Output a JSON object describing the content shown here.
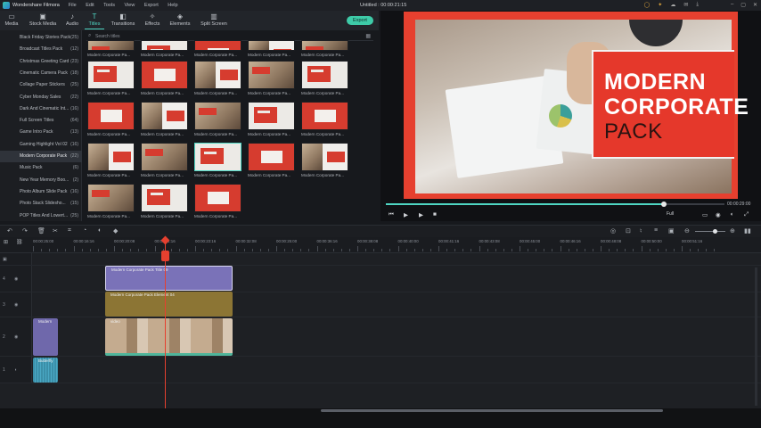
{
  "app": {
    "name": "Wondershare Filmora",
    "menu": [
      "File",
      "Edit",
      "Tools",
      "View",
      "Export",
      "Help"
    ],
    "project": "Untitled : 00:00:21:15"
  },
  "tabs": [
    {
      "label": "Media",
      "icon": "folder-icon"
    },
    {
      "label": "Stock Media",
      "icon": "stock-media-icon"
    },
    {
      "label": "Audio",
      "icon": "music-note-icon"
    },
    {
      "label": "Titles",
      "icon": "text-icon",
      "active": true
    },
    {
      "label": "Transitions",
      "icon": "transition-icon"
    },
    {
      "label": "Effects",
      "icon": "effects-icon"
    },
    {
      "label": "Elements",
      "icon": "elements-icon"
    },
    {
      "label": "Split Screen",
      "icon": "split-screen-icon"
    }
  ],
  "export_label": "Export",
  "search": {
    "placeholder": "Search titles"
  },
  "sidebar": [
    {
      "label": "Black Friday Stories Pack",
      "count": "(25)"
    },
    {
      "label": "Broadcast Titles Pack",
      "count": "(12)"
    },
    {
      "label": "Christmas Greeting Card",
      "count": "(23)"
    },
    {
      "label": "Cinematic Camera Pack",
      "count": "(18)"
    },
    {
      "label": "Collage Paper Stickers",
      "count": "(25)"
    },
    {
      "label": "Cyber Monday Sales",
      "count": "(22)"
    },
    {
      "label": "Dark And Cinematic Int...",
      "count": "(16)"
    },
    {
      "label": "Full Screen Titles",
      "count": "(64)"
    },
    {
      "label": "Game Intro Pack",
      "count": "(13)"
    },
    {
      "label": "Gaming Highlight Vol 02",
      "count": "(16)"
    },
    {
      "label": "Modern Corporate Pack",
      "count": "(22)",
      "active": true
    },
    {
      "label": "Music Pack",
      "count": "(6)"
    },
    {
      "label": "New Year Memory Boo...",
      "count": "(2)"
    },
    {
      "label": "Photo Album Slide Pack",
      "count": "(16)"
    },
    {
      "label": "Photo Stack Slidesho...",
      "count": "(15)"
    },
    {
      "label": "POP Titles And Lowert...",
      "count": "(25)"
    }
  ],
  "thumb_label": "Modern Corporate Pa...",
  "preview": {
    "title_line1": "MODERN",
    "title_line2": "CORPORATE",
    "title_line3": "PACK",
    "progress": 0.82,
    "time": "00:00:29:00",
    "quality": "Full"
  },
  "ruler_labels": [
    "00:00:25:00",
    "00:00:16:16",
    "00:00:20:08",
    "00:00:21:16",
    "00:00:23:16",
    "00:00:32:08",
    "00:00:25:00",
    "00:00:36:16",
    "00:00:38:08",
    "00:00:40:00",
    "00:00:41:16",
    "00:00:43:08",
    "00:00:45:00",
    "00:00:46:16",
    "00:00:48:08",
    "00:00:50:00",
    "00:00:51:16"
  ],
  "clips": {
    "title_clip": "Modern Corporate Pack Title 09",
    "element_clip": "Modern Corporate Pack Element 04",
    "video_clip": "video",
    "small_clip": "Modern",
    "audio_clip": "Butterfly"
  },
  "track_labels": [
    "4",
    "3",
    "2",
    "1"
  ],
  "colors": {
    "accent": "#4fd6c3",
    "brand_red": "#e5402f",
    "title_clip": "#7a72b8",
    "element_clip": "#8c7534",
    "audio_clip": "#3b8fa8"
  }
}
